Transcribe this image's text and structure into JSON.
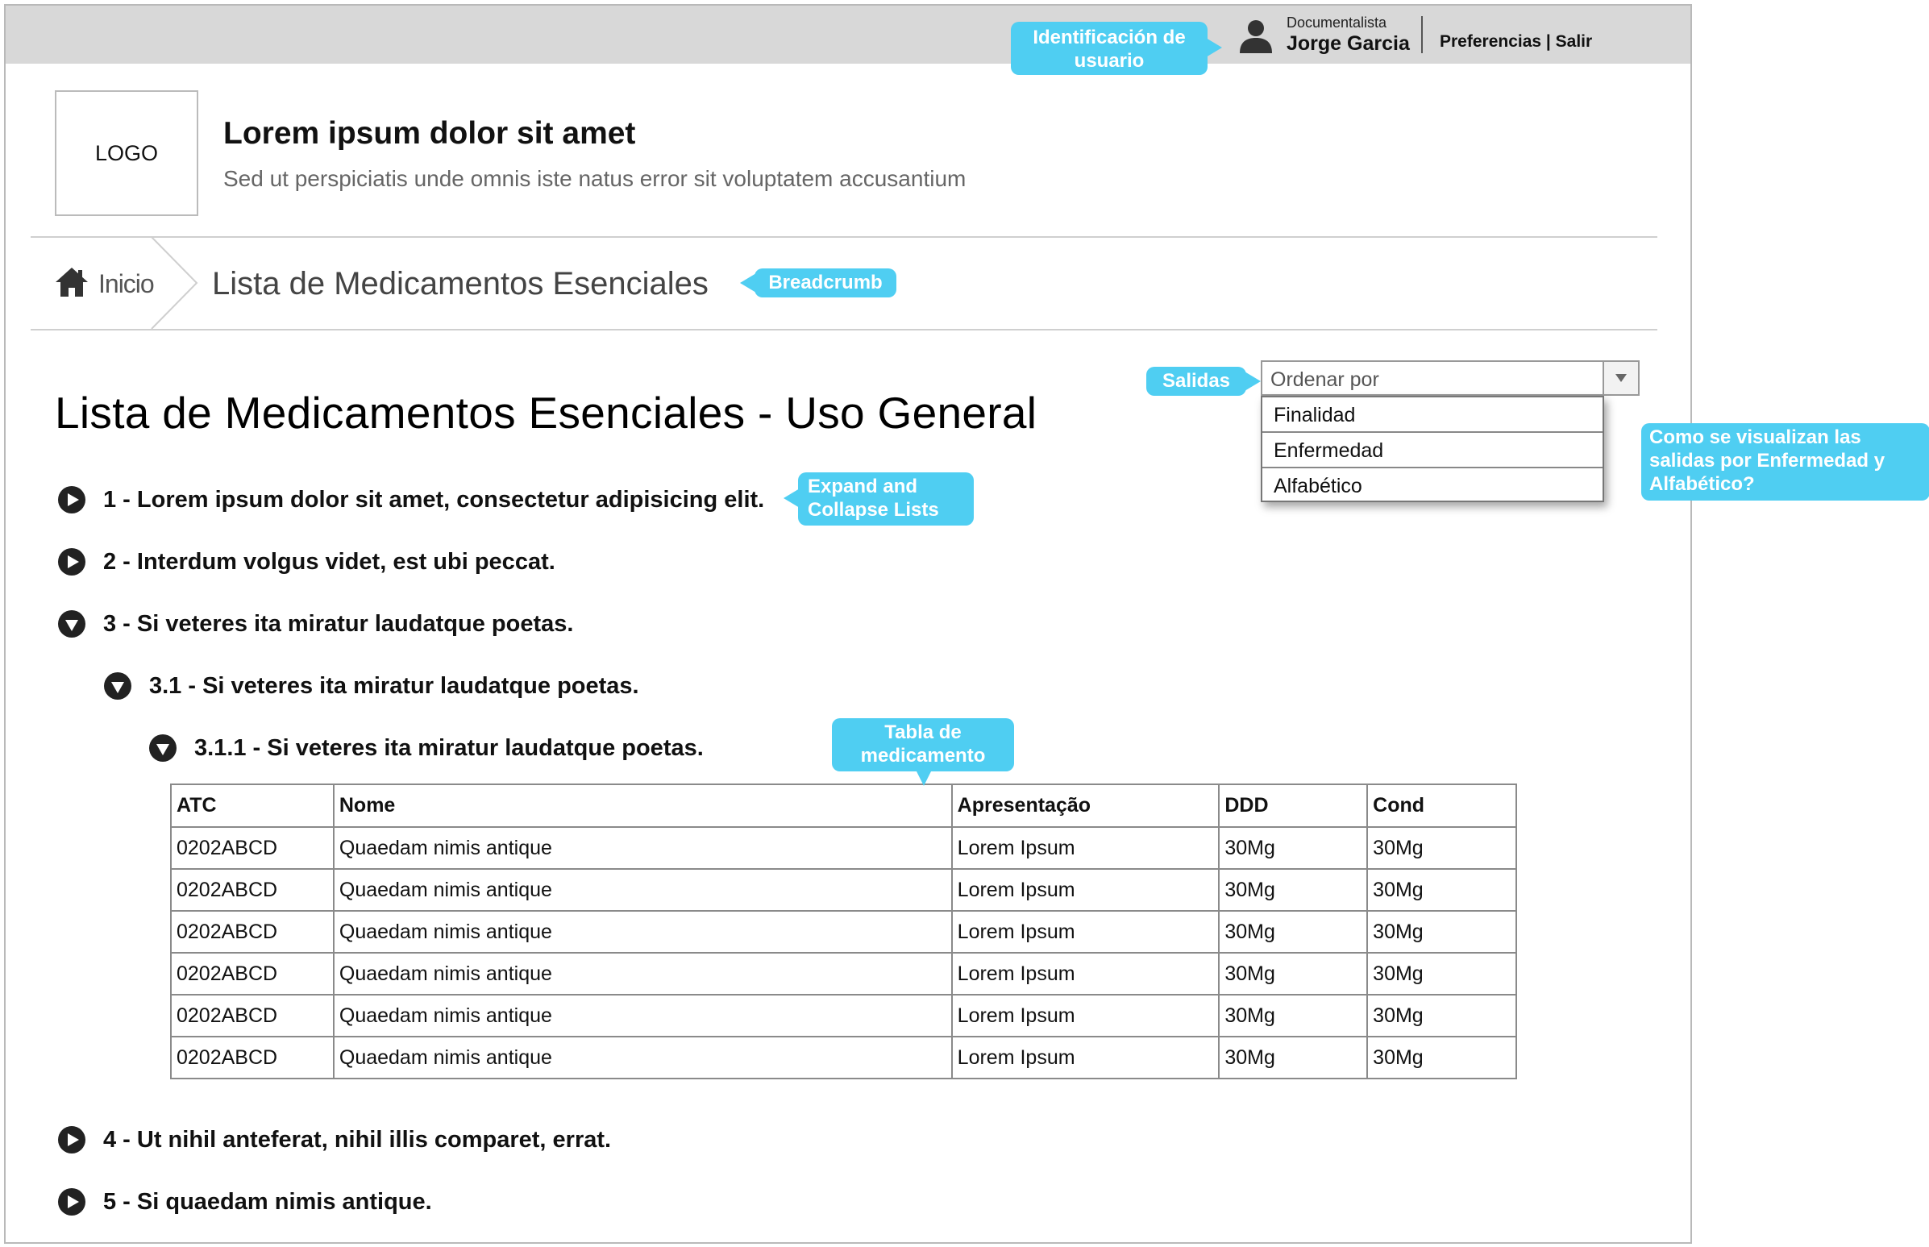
{
  "user": {
    "role": "Documentalista",
    "name": "Jorge Garcia",
    "preferences_label": "Preferencias",
    "separator": " | ",
    "logout_label": "Salir"
  },
  "header": {
    "logo_text": "LOGO",
    "title": "Lorem ipsum dolor sit amet",
    "subtitle": "Sed ut perspiciatis unde omnis iste natus error sit voluptatem accusantium"
  },
  "breadcrumb": {
    "home": "Inicio",
    "current": "Lista de Medicamentos Esenciales"
  },
  "page": {
    "title": "Lista de Medicamentos Esenciales - Uso General"
  },
  "sort": {
    "placeholder": "Ordenar por",
    "options": [
      "Finalidad",
      "Enfermedad",
      "Alfabético"
    ]
  },
  "tree": {
    "items": [
      "1 - Lorem ipsum dolor sit amet, consectetur adipisicing elit.",
      "2 - Interdum volgus videt, est ubi peccat.",
      "3 - Si veteres ita miratur laudatque poetas.",
      "3.1 - Si veteres ita miratur laudatque poetas.",
      "3.1.1 - Si veteres ita miratur laudatque poetas.",
      "4 - Ut nihil anteferat, nihil illis comparet, errat.",
      "5 - Si quaedam nimis antique."
    ]
  },
  "table": {
    "headers": [
      "ATC",
      "Nome",
      "Apresentação",
      "DDD",
      "Cond"
    ],
    "rows": [
      [
        "0202ABCD",
        "Quaedam nimis antique",
        "Lorem Ipsum",
        "30Mg",
        "30Mg"
      ],
      [
        "0202ABCD",
        "Quaedam nimis antique",
        "Lorem Ipsum",
        "30Mg",
        "30Mg"
      ],
      [
        "0202ABCD",
        "Quaedam nimis antique",
        "Lorem Ipsum",
        "30Mg",
        "30Mg"
      ],
      [
        "0202ABCD",
        "Quaedam nimis antique",
        "Lorem Ipsum",
        "30Mg",
        "30Mg"
      ],
      [
        "0202ABCD",
        "Quaedam nimis antique",
        "Lorem Ipsum",
        "30Mg",
        "30Mg"
      ],
      [
        "0202ABCD",
        "Quaedam nimis antique",
        "Lorem Ipsum",
        "30Mg",
        "30Mg"
      ]
    ]
  },
  "annotations": {
    "user_id": "Identificación de usuario",
    "breadcrumb": "Breadcrumb",
    "outputs": "Salidas",
    "outputs_question": "Como se visualizan las salidas por Enfermedad y Alfabético?",
    "expand_collapse": "Expand and Collapse Lists",
    "table": "Tabla de medicamento",
    "color": "#4fcef2"
  }
}
